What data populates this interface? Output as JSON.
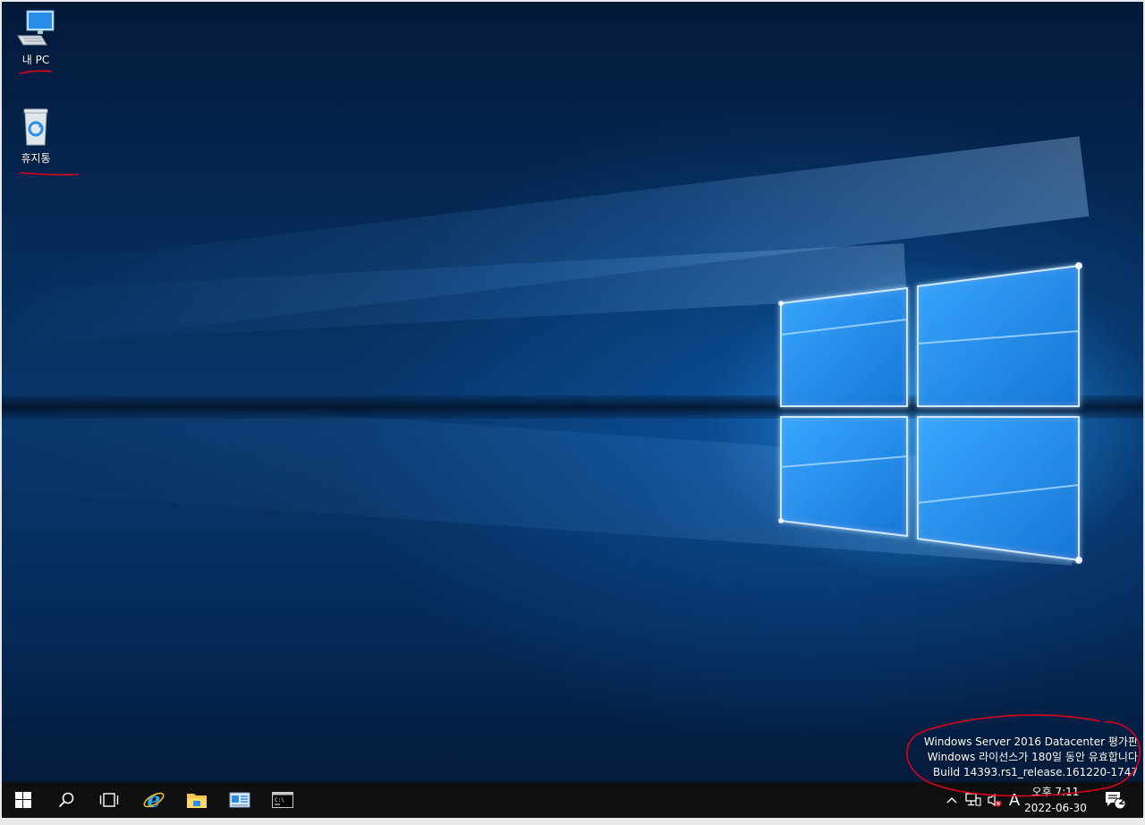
{
  "desktop": {
    "icons": [
      {
        "label": "내 PC",
        "icon": "computer-icon"
      },
      {
        "label": "휴지통",
        "icon": "recycle-bin-icon"
      }
    ],
    "watermark": {
      "line1": "Windows Server 2016 Datacenter 평가판",
      "line2": "Windows 라이선스가 180일 동안 유효합니다",
      "line3": "Build 14393.rs1_release.161220-1747"
    },
    "annotation_color": "#e0001b"
  },
  "taskbar": {
    "buttons": [
      {
        "icon": "windows-start-icon"
      },
      {
        "icon": "search-icon"
      },
      {
        "icon": "task-view-icon"
      },
      {
        "icon": "internet-explorer-icon"
      },
      {
        "icon": "file-explorer-icon"
      },
      {
        "icon": "server-manager-icon"
      },
      {
        "icon": "command-prompt-icon"
      }
    ],
    "tray": {
      "chevron": "^",
      "network_icon": "network-icon",
      "volume_icon": "volume-muted-icon",
      "ime_label": "A",
      "time": "오후 7:11",
      "date": "2022-06-30",
      "notification_count": "2"
    }
  },
  "colors": {
    "accent": "#1e8fff",
    "taskbar": "#0f0f0f",
    "annotation": "#e0001b"
  }
}
